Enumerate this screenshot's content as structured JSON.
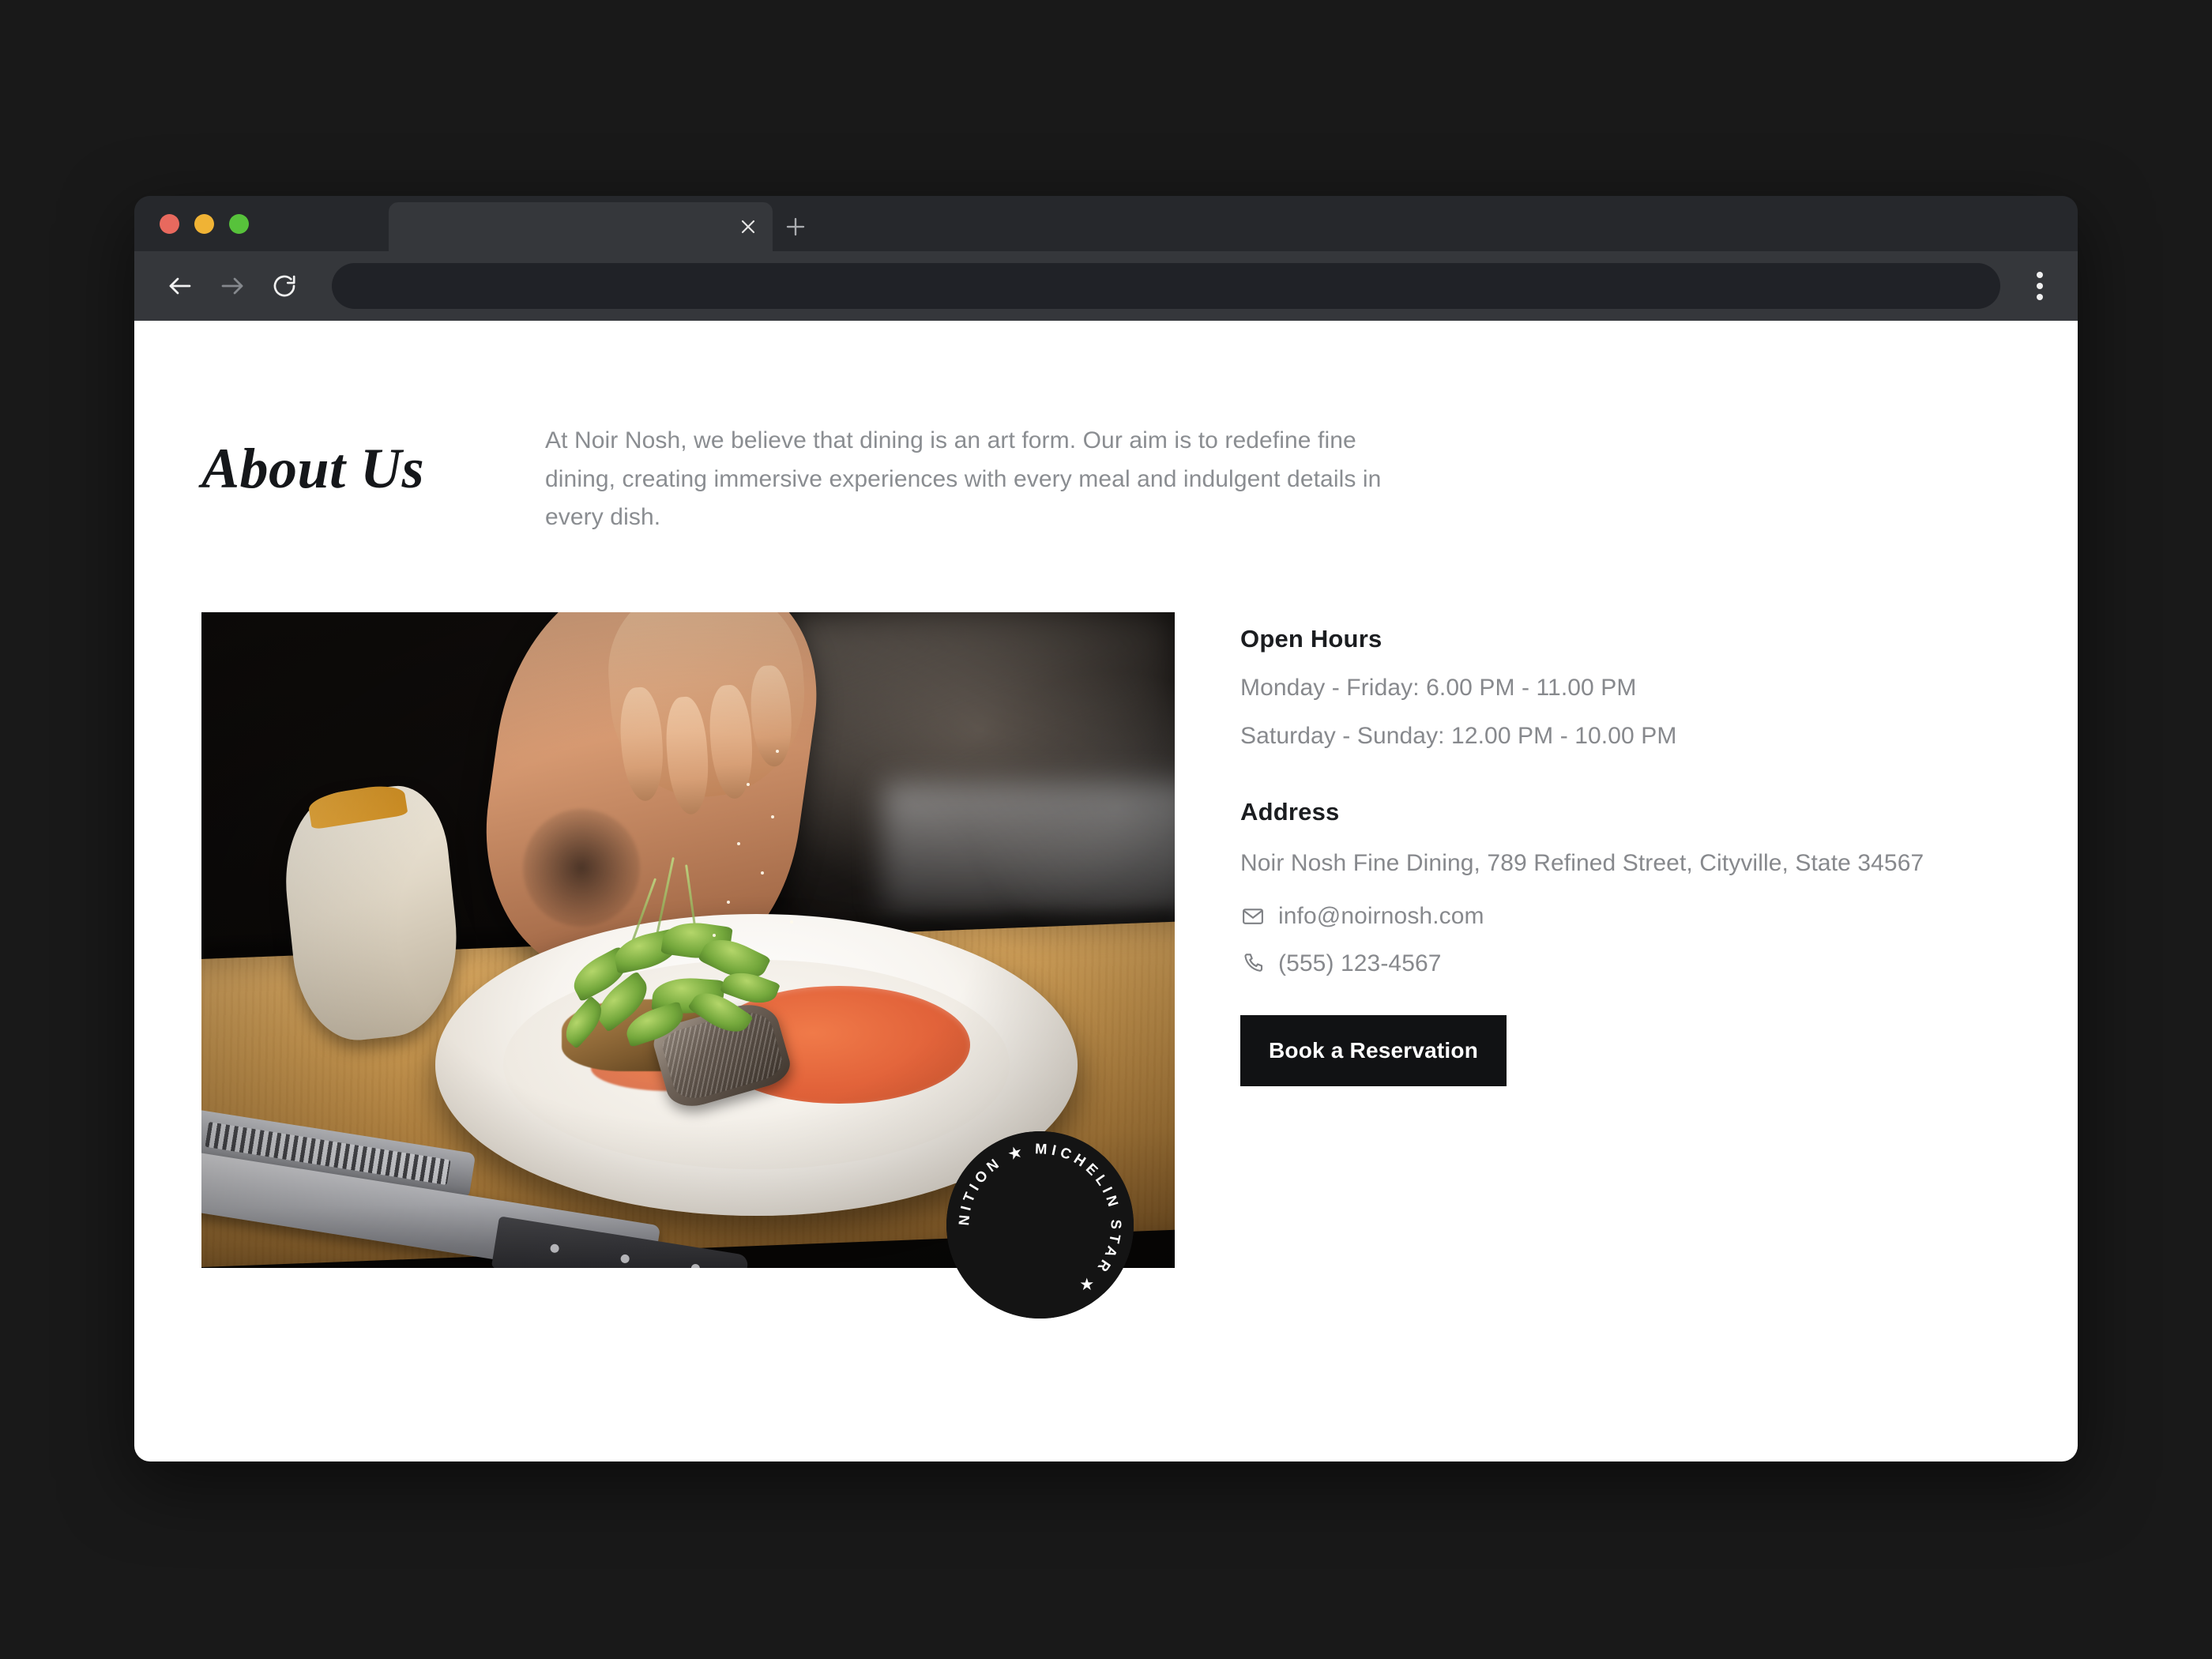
{
  "browser": {
    "tab_title": "",
    "tab_close_icon": "close-icon",
    "new_tab_icon": "plus-icon",
    "back_icon": "arrow-left-icon",
    "forward_icon": "arrow-right-icon",
    "reload_icon": "reload-icon",
    "menu_icon": "kebab-menu-icon",
    "address_value": "",
    "address_placeholder": "",
    "traffic_lights": {
      "close": "#e8695e",
      "minimize": "#f0b335",
      "maximize": "#57c23b"
    },
    "chrome_bg": "#26282c",
    "toolbar_bg": "#35373b",
    "omnibox_bg": "#202227"
  },
  "page": {
    "about": {
      "title": "About Us",
      "paragraph": "At Noir Nosh, we believe that dining is an art form. Our aim is to redefine fine dining, creating immersive experiences with every meal and indulgent details in every dish."
    },
    "photo": {
      "alt": "Chef plating a dish with microgreens and orange sauce on a white plate",
      "badge": {
        "text": "RECOGNITION ★ MICHELIN STAR ★",
        "bg": "#141414",
        "fg": "#ffffff"
      }
    },
    "info": {
      "hours_heading": "Open Hours",
      "hours": [
        "Monday - Friday: 6.00 PM - 11.00 PM",
        "Saturday - Sunday: 12.00 PM - 10.00 PM"
      ],
      "address_heading": "Address",
      "address": "Noir Nosh Fine Dining, 789 Refined Street, Cityville, State 34567",
      "email": "info@noirnosh.com",
      "email_icon": "envelope-icon",
      "phone": "(555) 123-4567",
      "phone_icon": "phone-icon",
      "cta_label": "Book a Reservation",
      "cta_bg": "#111214",
      "cta_fg": "#ffffff"
    }
  },
  "theme": {
    "page_bg": "#ffffff",
    "desktop_bg": "#191919",
    "heading_color": "#1b1d20",
    "body_color": "#87898d"
  }
}
